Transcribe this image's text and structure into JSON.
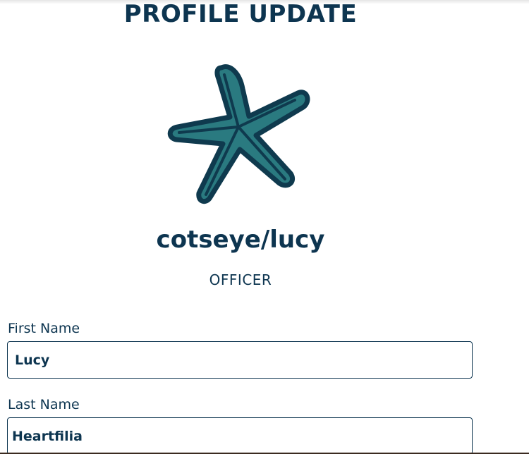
{
  "header": {
    "title": "PROFILE UPDATE"
  },
  "profile": {
    "avatar_icon": "starfish-icon",
    "username": "cotseye/lucy",
    "role": "OFFICER"
  },
  "form": {
    "first_name": {
      "label": "First Name",
      "value": "Lucy"
    },
    "last_name": {
      "label": "Last Name",
      "value": "Heartfilia"
    }
  },
  "colors": {
    "text": "#0d3550",
    "starfish_fill": "#2a7a80",
    "starfish_outline": "#0f3a4e"
  }
}
